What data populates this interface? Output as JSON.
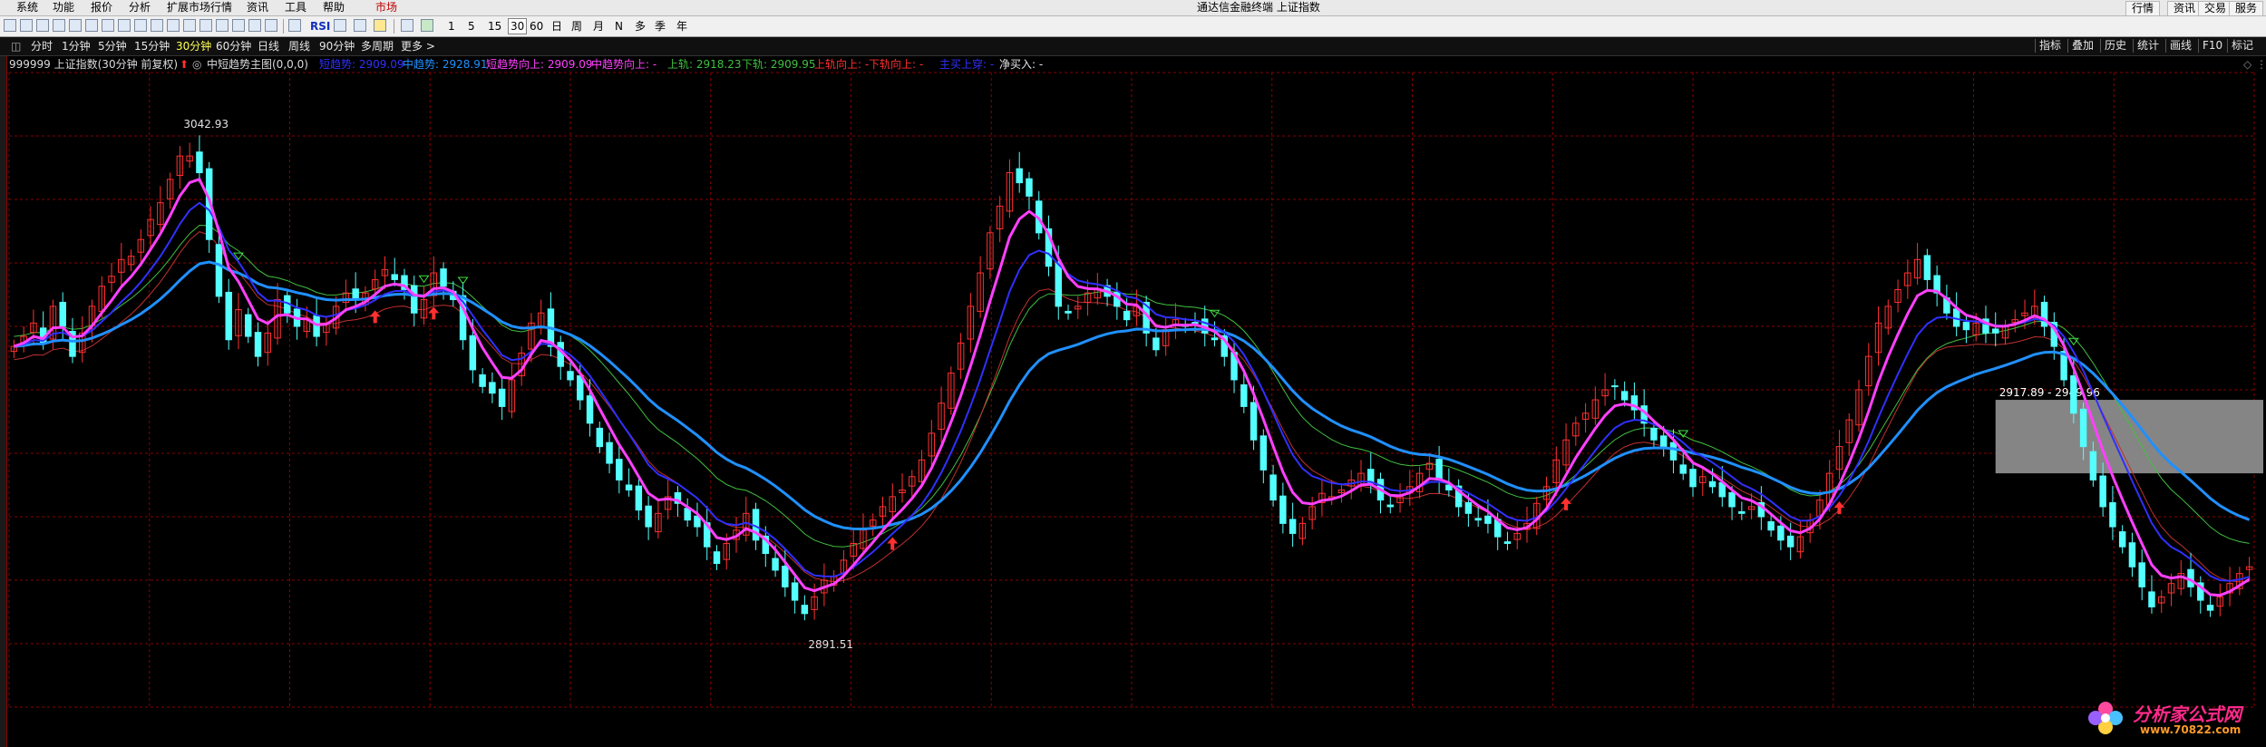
{
  "window": {
    "title": "通达信金融终端  上证指数"
  },
  "menu": [
    "系统",
    "功能",
    "报价",
    "分析",
    "扩展市场行情",
    "资讯",
    "工具",
    "帮助",
    "市场"
  ],
  "right_tabs": [
    "行情",
    "资讯",
    "交易",
    "服务"
  ],
  "toolbar": {
    "rsi_label": "RSI",
    "periods": [
      "1",
      "5",
      "15",
      "30",
      "60",
      "日",
      "周",
      "月",
      "N",
      "多",
      "季",
      "年"
    ],
    "active_period": "30"
  },
  "period_bar": {
    "items": [
      "分时",
      "1分钟",
      "5分钟",
      "15分钟",
      "30分钟",
      "60分钟",
      "日线",
      "周线",
      "90分钟",
      "多周期",
      "更多 >"
    ],
    "active": "30分钟",
    "right_items": [
      "指标",
      "叠加",
      "历史",
      "统计",
      "画线",
      "F10",
      "标记"
    ]
  },
  "legend": {
    "stock": "999999 上证指数(30分钟 前复权)",
    "indicator": "中短趋势主图(0,0,0)",
    "short_trend": "短趋势: 2909.09",
    "mid_trend": "中趋势: 2928.91",
    "short_up": "短趋势向上: 2909.09",
    "mid_up": "中趋势向上: -",
    "upper_rail": "上轨: 2918.23",
    "lower_rail": "下轨: 2909.95",
    "upper_up": "上轨向上: -",
    "lower_up": "下轨向上: -",
    "signal": "主买上穿: -",
    "net_buy": "净买入: -"
  },
  "annotations": {
    "high_label": "3042.93",
    "low_label": "2891.51",
    "range_label": "2917.89 - 2949.96"
  },
  "watermark": {
    "line1": "分析家公式网",
    "line2": "www.70822.com"
  },
  "colors": {
    "up": "#ff3030",
    "down": "#54ffff",
    "short_trend": "#ff40ff",
    "mid_trend": "#2090ff",
    "blue_line": "#3030ff",
    "upper_rail": "#40c040",
    "lower_rail": "#c03030",
    "grid": "#8a0000",
    "menu_active": "#c00000"
  },
  "chart_data": {
    "type": "candlestick",
    "ylim": [
      2870,
      3060
    ],
    "max_marker": 3042.93,
    "min_marker": 2891.51,
    "close": [
      2978,
      2981,
      2985,
      2979,
      2990,
      2984,
      2975,
      2982,
      2990,
      2996,
      2999,
      3004,
      3005,
      3010,
      3016,
      3021,
      3028,
      3035,
      3035,
      3030,
      3010,
      2993,
      2980,
      2989,
      2981,
      2975,
      2982,
      2992,
      2988,
      2984,
      2986,
      2981,
      2985,
      2990,
      2994,
      2992,
      2994,
      2998,
      3001,
      2998,
      2995,
      2988,
      2992,
      3000,
      2996,
      2992,
      2980,
      2971,
      2966,
      2964,
      2960,
      2968,
      2976,
      2985,
      2988,
      2978,
      2972,
      2968,
      2962,
      2955,
      2948,
      2943,
      2938,
      2935,
      2929,
      2924,
      2928,
      2933,
      2931,
      2926,
      2924,
      2918,
      2913,
      2919,
      2923,
      2928,
      2920,
      2916,
      2911,
      2906,
      2902,
      2898,
      2903,
      2908,
      2909,
      2914,
      2919,
      2923,
      2926,
      2930,
      2933,
      2935,
      2939,
      2944,
      2952,
      2961,
      2970,
      2979,
      2990,
      3000,
      3012,
      3020,
      3030,
      3027,
      3023,
      3012,
      3002,
      2990,
      2988,
      2990,
      2994,
      2995,
      2993,
      2990,
      2986,
      2990,
      2982,
      2977,
      2983,
      2986,
      2984,
      2985,
      2982,
      2980,
      2975,
      2968,
      2960,
      2950,
      2941,
      2932,
      2925,
      2922,
      2925,
      2930,
      2934,
      2933,
      2935,
      2938,
      2940,
      2937,
      2932,
      2930,
      2933,
      2936,
      2940,
      2943,
      2938,
      2935,
      2930,
      2928,
      2926,
      2925,
      2921,
      2919,
      2922,
      2925,
      2931,
      2936,
      2944,
      2950,
      2955,
      2958,
      2962,
      2965,
      2966,
      2962,
      2959,
      2955,
      2950,
      2948,
      2944,
      2940,
      2936,
      2939,
      2936,
      2933,
      2930,
      2928,
      2930,
      2927,
      2923,
      2920,
      2918,
      2921,
      2926,
      2932,
      2940,
      2948,
      2956,
      2965,
      2975,
      2985,
      2990,
      2995,
      3000,
      3004,
      2998,
      2994,
      2988,
      2984,
      2983,
      2985,
      2982,
      2982,
      2984,
      2986,
      2988,
      2990,
      2984,
      2978,
      2968,
      2958,
      2948,
      2938,
      2930,
      2924,
      2918,
      2912,
      2906,
      2900,
      2903,
      2907,
      2910,
      2906,
      2902,
      2899,
      2903,
      2907,
      2910,
      2912
    ]
  }
}
